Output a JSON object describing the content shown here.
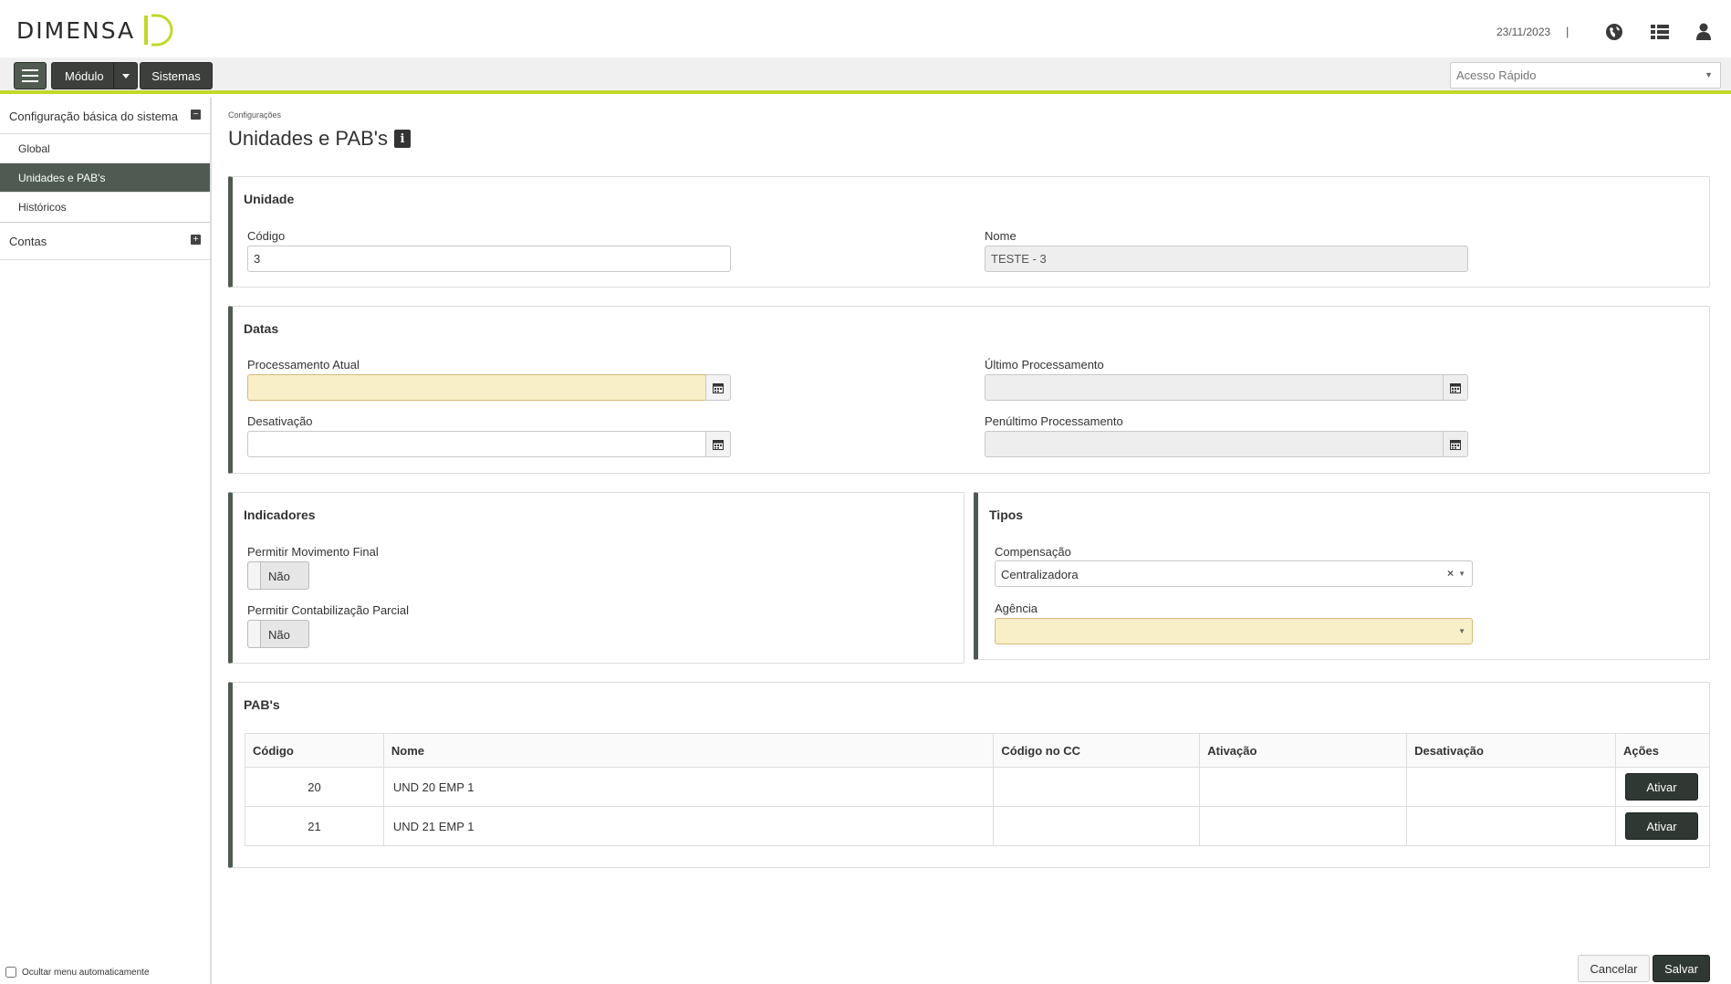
{
  "header": {
    "logo_text": "Dimensa",
    "date": "23/11/2023",
    "separator": "|",
    "icons": [
      "globe-icon",
      "list-icon",
      "user-icon"
    ]
  },
  "toolbar": {
    "modulo_label": "Módulo",
    "sistemas_label": "Sistemas",
    "quick_access_placeholder": "Acesso Rápido"
  },
  "sidebar": {
    "group1": "Configuração básica do sistema",
    "items": [
      "Global",
      "Unidades e PAB's",
      "Históricos"
    ],
    "group2": "Contas",
    "footer_checkbox": "Ocultar menu automaticamente"
  },
  "breadcrumb": "Configurações",
  "page_title": "Unidades e PAB's",
  "unidade": {
    "title": "Unidade",
    "codigo_label": "Código",
    "codigo_value": "3",
    "nome_label": "Nome",
    "nome_value": "TESTE - 3"
  },
  "datas": {
    "title": "Datas",
    "proc_atual_label": "Processamento Atual",
    "ultimo_label": "Último Processamento",
    "desativacao_label": "Desativação",
    "penultimo_label": "Penúltimo Processamento"
  },
  "indicadores": {
    "title": "Indicadores",
    "mov_final_label": "Permitir Movimento Final",
    "mov_final_value": "Não",
    "contab_parcial_label": "Permitir Contabilização Parcial",
    "contab_parcial_value": "Não"
  },
  "tipos": {
    "title": "Tipos",
    "compensacao_label": "Compensação",
    "compensacao_value": "Centralizadora",
    "agencia_label": "Agência",
    "agencia_value": ""
  },
  "pabs": {
    "title": "PAB's",
    "columns": [
      "Código",
      "Nome",
      "Código no CC",
      "Ativação",
      "Desativação",
      "Ações"
    ],
    "rows": [
      {
        "codigo": "20",
        "nome": "UND 20 EMP 1",
        "codigo_cc": "",
        "ativacao": "",
        "desativacao": "",
        "action": "Ativar"
      },
      {
        "codigo": "21",
        "nome": "UND 21 EMP 1",
        "codigo_cc": "",
        "ativacao": "",
        "desativacao": "",
        "action": "Ativar"
      }
    ]
  },
  "footer": {
    "cancel_label": "Cancelar",
    "save_label": "Salvar"
  },
  "colors": {
    "accent": "#c2d82a",
    "dark": "#2f3832",
    "sidebar_active": "#4f5b52",
    "required_field": "#f8efc8"
  }
}
